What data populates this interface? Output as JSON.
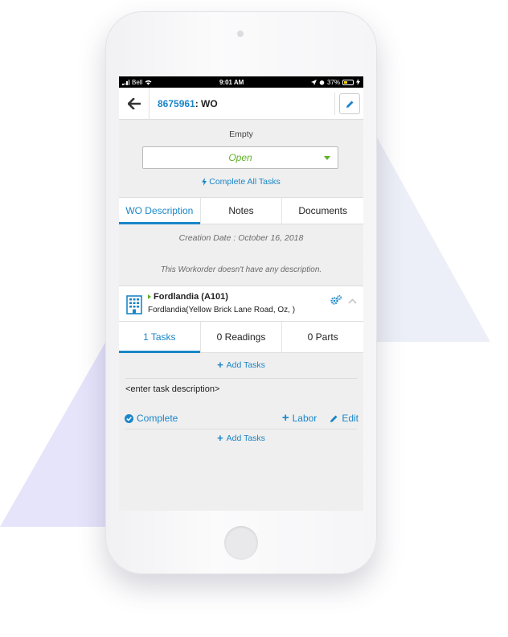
{
  "statusbar": {
    "carrier": "Bell",
    "time": "9:01 AM",
    "battery": "37%"
  },
  "header": {
    "wo_number": "8675961",
    "title_suffix": ": WO"
  },
  "status": {
    "label": "Empty",
    "selected": "Open",
    "complete_all": "Complete All Tasks"
  },
  "tabs": [
    "WO Description",
    "Notes",
    "Documents"
  ],
  "description": {
    "creation_date": "Creation Date : October 16, 2018",
    "empty_text": "This Workorder doesn't have any description."
  },
  "location": {
    "name": "Fordlandia (A101)",
    "address": "Fordlandia(Yellow Brick Lane Road, Oz, )"
  },
  "subtabs": [
    "1 Tasks",
    "0 Readings",
    "0 Parts"
  ],
  "tasks": {
    "add_tasks_label": "Add Tasks",
    "task_description": "<enter task description>",
    "complete_label": "Complete",
    "labor_label": "Labor",
    "edit_label": "Edit"
  },
  "colors": {
    "accent": "#1a86c8",
    "status_green": "#5db225"
  }
}
